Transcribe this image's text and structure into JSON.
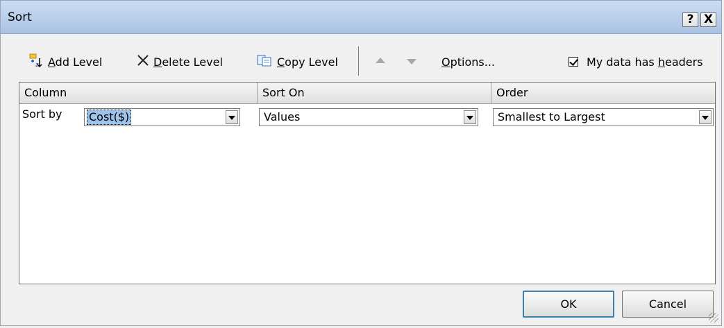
{
  "window": {
    "title": "Sort",
    "help_label": "?",
    "close_label": "X"
  },
  "toolbar": {
    "add_level": {
      "accel": "A",
      "rest": "dd Level"
    },
    "delete_level": {
      "accel": "D",
      "rest": "elete Level"
    },
    "copy_level": {
      "accel": "C",
      "rest": "opy Level"
    },
    "options": {
      "accel": "O",
      "rest": "ptions..."
    },
    "headers": {
      "prefix": "My data has ",
      "accel": "h",
      "rest": "eaders",
      "checked": true
    }
  },
  "grid": {
    "columns": [
      "Column",
      "Sort On",
      "Order"
    ],
    "rows": [
      {
        "label": "Sort by",
        "column": "Cost($)",
        "sort_on": "Values",
        "order": "Smallest to Largest"
      }
    ]
  },
  "buttons": {
    "ok": "OK",
    "cancel": "Cancel"
  },
  "colors": {
    "titlebar": "#bcd1ec",
    "selection": "#9fc4ec",
    "default_button_border": "#3c7fb1"
  }
}
